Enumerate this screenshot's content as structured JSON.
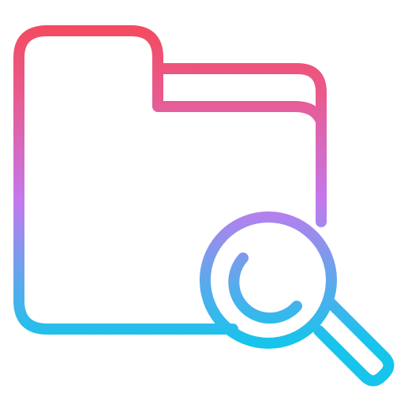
{
  "icon": {
    "name": "folder-search-icon",
    "gradient": {
      "top": "#F44A5D",
      "upper_mid": "#E95A8F",
      "mid": "#C478EE",
      "lower_mid": "#5FA8EC",
      "bottom": "#16C4EC"
    }
  }
}
